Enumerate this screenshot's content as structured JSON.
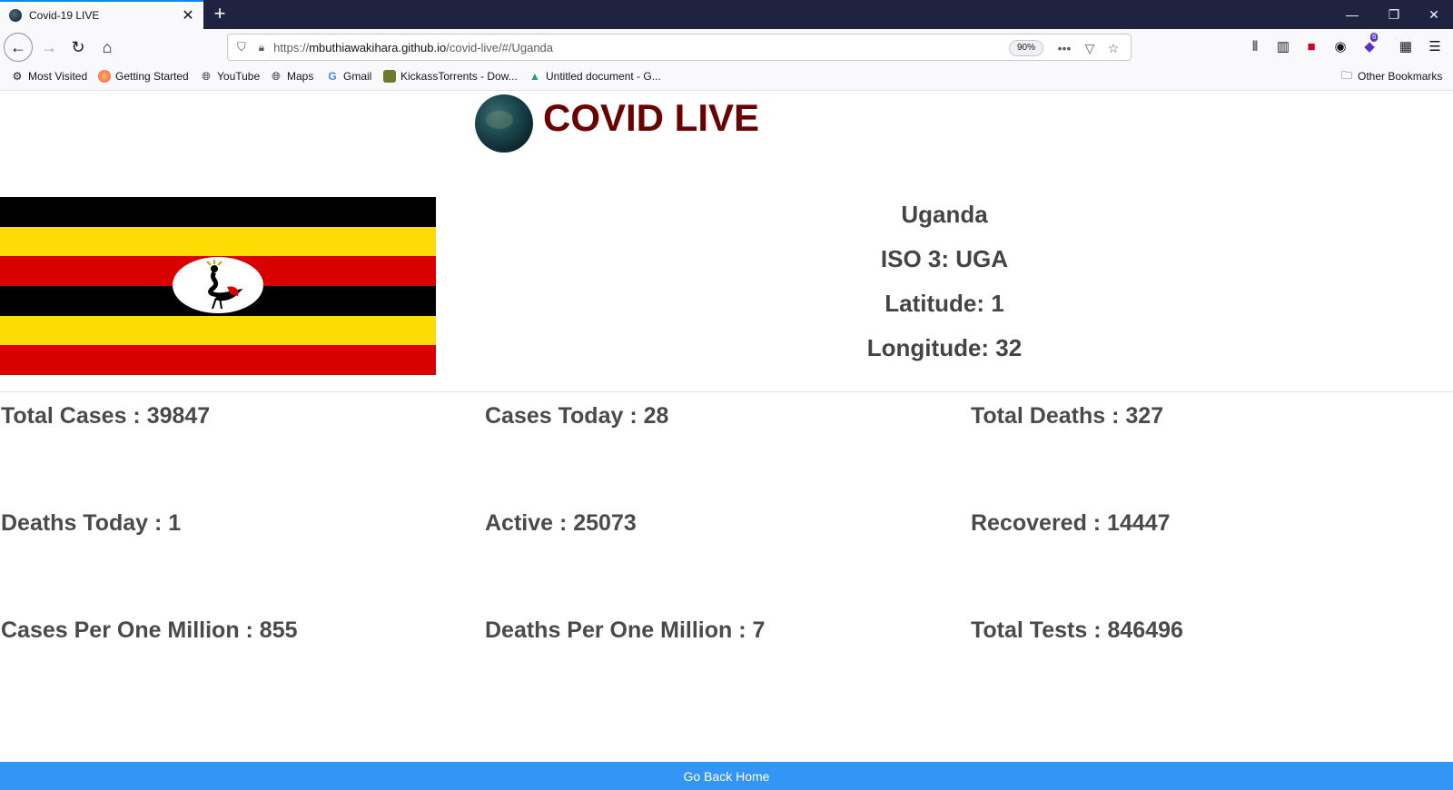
{
  "browser": {
    "tab_title": "Covid-19 LIVE",
    "url_prefix": "https://",
    "url_host": "mbuthiawakihara.github.io",
    "url_path": "/covid-live/#/Uganda",
    "zoom": "90%",
    "bookmarks": [
      "Most Visited",
      "Getting Started",
      "YouTube",
      "Maps",
      "Gmail",
      "KickassTorrents - Dow...",
      "Untitled document - G..."
    ],
    "other_bookmarks": "Other Bookmarks",
    "badge_count": "6"
  },
  "site": {
    "title": "COVID LIVE"
  },
  "country": {
    "name": "Uganda",
    "iso3": "ISO 3: UGA",
    "latitude": "Latitude: 1",
    "longitude": "Longitude: 32",
    "flag_colors": [
      "#000000",
      "#FCDC04",
      "#D90000",
      "#000000",
      "#FCDC04",
      "#D90000"
    ]
  },
  "stats": [
    "Total Cases : 39847",
    "Cases Today : 28",
    "Total Deaths : 327",
    "Deaths Today : 1",
    "Active : 25073",
    "Recovered : 14447",
    "Cases Per One Million : 855",
    "Deaths Per One Million : 7",
    "Total Tests : 846496"
  ],
  "footer": {
    "label": "Go Back Home"
  },
  "colors": {
    "title": "#6b0000",
    "footer": "#3395f5"
  }
}
